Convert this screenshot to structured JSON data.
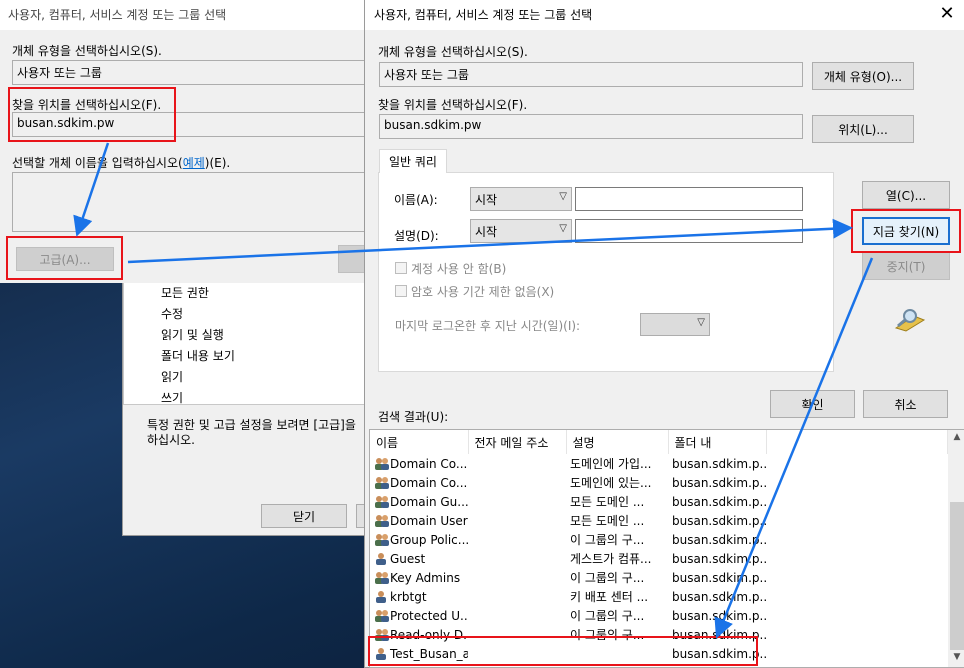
{
  "left_dialog": {
    "title": "사용자, 컴퓨터, 서비스 계정 또는 그룹 선택",
    "object_type_label": "개체 유형을 선택하십시오(S).",
    "object_type_value": "사용자 또는 그룹",
    "location_label": "찾을 위치를 선택하십시오(F).",
    "location_value": "busan.sdkim.pw",
    "enter_names_label_pre": "선택할 개체 이름을 입력하십시오(",
    "enter_names_link": "예제",
    "enter_names_label_post": ")(E).",
    "advanced_button": "고급(A)..."
  },
  "perm_dialog": {
    "permissions": [
      "모든 권한",
      "수정",
      "읽기 및 실행",
      "폴더 내용 보기",
      "읽기",
      "쓰기"
    ],
    "note_line1": "특정 권한 및 고급 설정을 보려면 [고급]을",
    "note_line2": "하십시오.",
    "close_button": "닫기"
  },
  "right_dialog": {
    "title": "사용자, 컴퓨터, 서비스 계정 또는 그룹 선택",
    "object_type_label": "개체 유형을 선택하십시오(S).",
    "object_type_value": "사용자 또는 그룹",
    "object_types_button": "개체 유형(O)...",
    "location_label": "찾을 위치를 선택하십시오(F).",
    "location_value": "busan.sdkim.pw",
    "locations_button": "위치(L)...",
    "tab_label": "일반 쿼리",
    "name_label": "이름(A):",
    "name_condition": "시작",
    "desc_label": "설명(D):",
    "desc_condition": "시작",
    "disabled_accounts": "계정 사용 안 함(B)",
    "non_expiring_password": "암호 사용 기간 제한 없음(X)",
    "days_since_logon": "마지막 로그온한 후 지난 시간(일)(I):",
    "columns_button": "열(C)...",
    "find_now_button": "지금 찾기(N)",
    "stop_button": "중지(T)",
    "ok_button": "확인",
    "cancel_button": "취소",
    "results_label": "검색 결과(U):",
    "columns": [
      "이름",
      "전자 메일 주소",
      "설명",
      "폴더 내"
    ],
    "rows": [
      {
        "name": "Domain Co...",
        "email": "",
        "desc": "도메인에 가입...",
        "folder": "busan.sdkim.p...",
        "icon": "group-icon"
      },
      {
        "name": "Domain Co...",
        "email": "",
        "desc": "도메인에 있는...",
        "folder": "busan.sdkim.p...",
        "icon": "group-icon"
      },
      {
        "name": "Domain Gu...",
        "email": "",
        "desc": "모든 도메인 ...",
        "folder": "busan.sdkim.p...",
        "icon": "group-icon"
      },
      {
        "name": "Domain Users",
        "email": "",
        "desc": "모든 도메인 ...",
        "folder": "busan.sdkim.p...",
        "icon": "group-icon"
      },
      {
        "name": "Group Polic...",
        "email": "",
        "desc": "이 그룹의 구...",
        "folder": "busan.sdkim.p...",
        "icon": "group-icon"
      },
      {
        "name": "Guest",
        "email": "",
        "desc": "게스트가 컴퓨...",
        "folder": "busan.sdkim.p...",
        "icon": "user-icon"
      },
      {
        "name": "Key Admins",
        "email": "",
        "desc": "이 그룹의 구...",
        "folder": "busan.sdkim.p...",
        "icon": "group-icon"
      },
      {
        "name": "krbtgt",
        "email": "",
        "desc": "키 배포 센터 ...",
        "folder": "busan.sdkim.p...",
        "icon": "user-icon"
      },
      {
        "name": "Protected U...",
        "email": "",
        "desc": "이 그룹의 구...",
        "folder": "busan.sdkim.p...",
        "icon": "group-icon"
      },
      {
        "name": "Read-only D...",
        "email": "",
        "desc": "이 그룹의 구...",
        "folder": "busan.sdkim.p...",
        "icon": "group-icon"
      },
      {
        "name": "Test_Busan_aa",
        "email": "",
        "desc": "",
        "folder": "busan.sdkim.p...",
        "icon": "user-icon"
      }
    ]
  },
  "colors": {
    "highlight_box": "#e8141a",
    "arrow": "#1a73e8",
    "link": "#0066cc"
  }
}
